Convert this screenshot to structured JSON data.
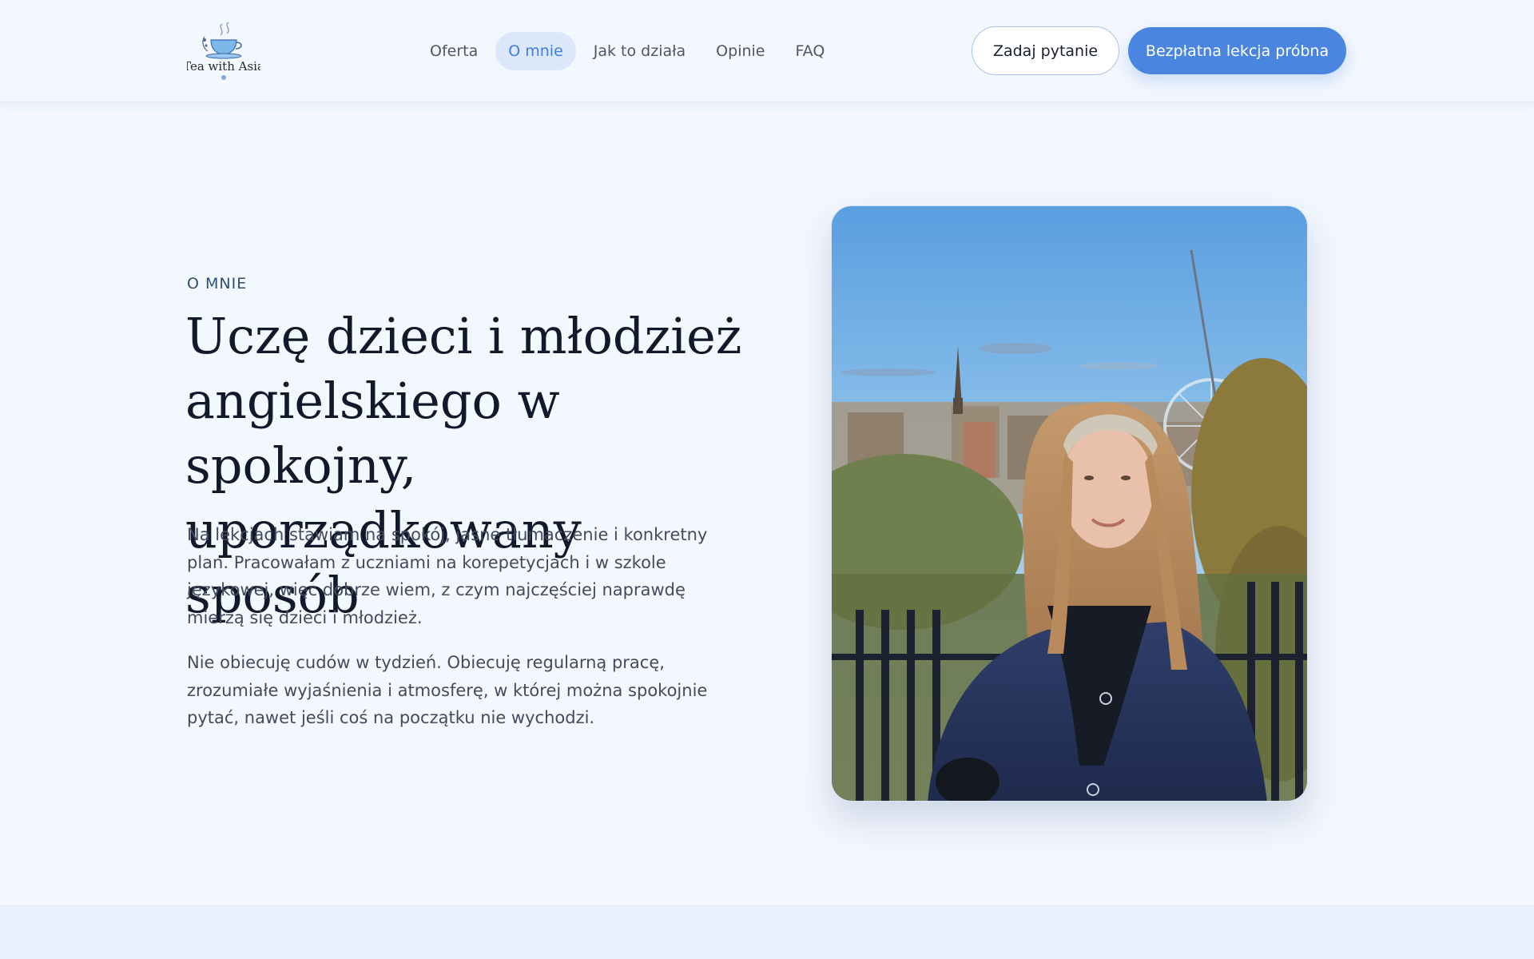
{
  "brand": {
    "logo_icon": "teacup-icon",
    "name_text": "Tea with Asia"
  },
  "nav": {
    "items": [
      {
        "label": "Oferta",
        "active": false
      },
      {
        "label": "O mnie",
        "active": true
      },
      {
        "label": "Jak to działa",
        "active": false
      },
      {
        "label": "Opinie",
        "active": false
      },
      {
        "label": "FAQ",
        "active": false
      }
    ]
  },
  "header_actions": {
    "ask_label": "Zadaj pytanie",
    "trial_label": "Bezpłatna lekcja próbna"
  },
  "hero": {
    "eyebrow": "O MNIE",
    "title_lines": [
      "Uczę dzieci i młodzież",
      "angielskiego w spokojny,",
      "uporządkowany sposób"
    ],
    "paragraph_1": "Na lekcjach stawiam na spokój, jasne tłumaczenie i konkretny plan. Pracowałam z uczniami na korepetycjach i w szkole językowej, więc dobrze wiem, z czym najczęściej naprawdę mierzą się dzieci i młodzież.",
    "paragraph_2": "Nie obiecuję cudów w tydzień. Obiecuję regularną pracę, zrozumiałe wyjaśnienia i atmosferę, w której można spokojnie pytać, nawet jeśli coś na początku nie wychodzi."
  },
  "colors": {
    "accent": "#4a86df",
    "active_nav_bg": "#dce7fa",
    "background": "#f3f7fe"
  }
}
